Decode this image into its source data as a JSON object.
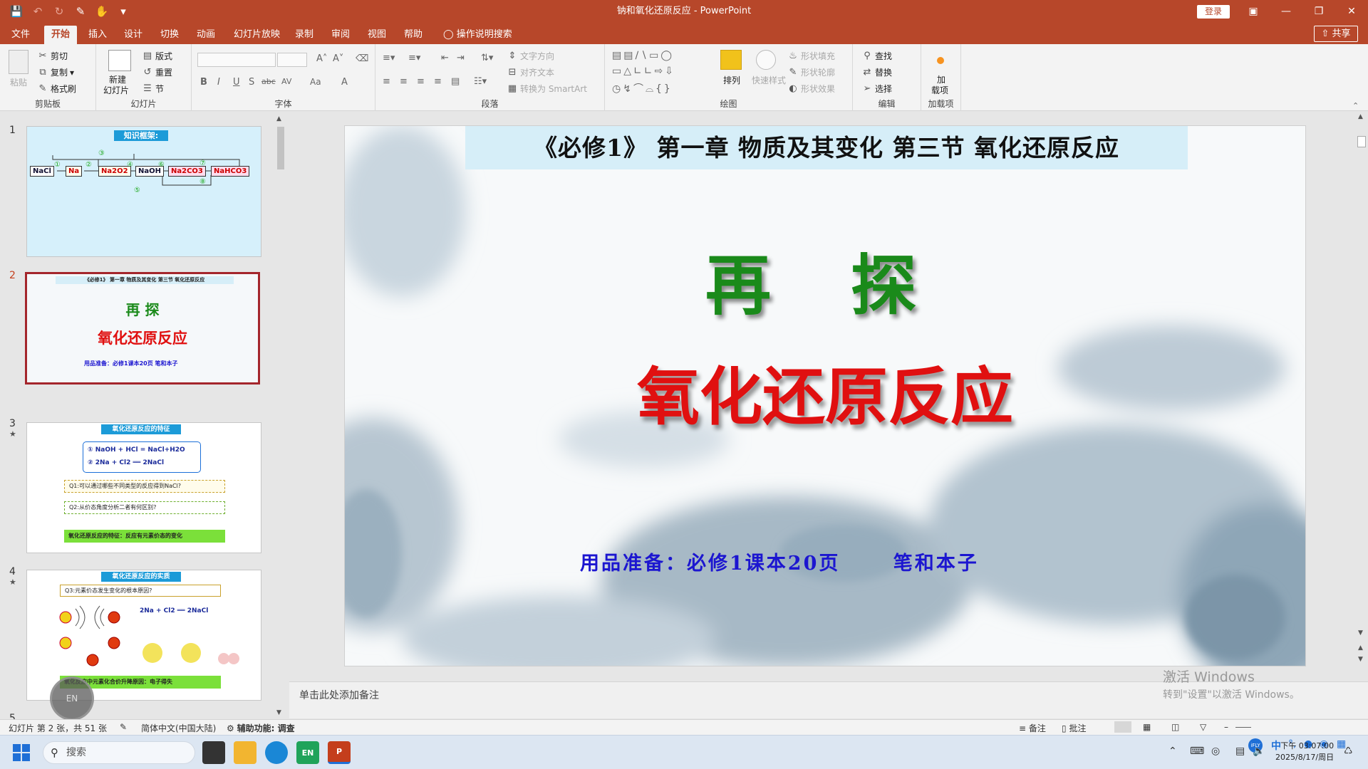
{
  "titlebar": {
    "doc_title": "钠和氧化还原反应  -  PowerPoint",
    "login_label": "登录",
    "bg_color": "#b7472a",
    "qat_icons": [
      "save-icon",
      "undo-icon",
      "redo-icon",
      "format-painter-icon",
      "touch-mode-icon",
      "customize-icon"
    ]
  },
  "menu": {
    "tabs": [
      "文件",
      "开始",
      "插入",
      "设计",
      "切换",
      "动画",
      "幻灯片放映",
      "录制",
      "审阅",
      "视图",
      "帮助"
    ],
    "active_tab": "开始",
    "search_label": "操作说明搜索",
    "share_label": "共享"
  },
  "ribbon": {
    "clipboard": {
      "label": "剪贴板",
      "paste": "粘贴",
      "cut": "剪切",
      "copy": "复制",
      "format_painter": "格式刷"
    },
    "slides": {
      "label": "幻灯片",
      "new_slide_line1": "新建",
      "new_slide_line2": "幻灯片",
      "layout": "版式",
      "reset": "重置",
      "section": "节"
    },
    "font": {
      "label": "字体",
      "buttons": [
        "B",
        "I",
        "U",
        "S",
        "abc",
        "AV",
        "Aa",
        "A"
      ]
    },
    "paragraph": {
      "label": "段落",
      "text_direction": "文字方向",
      "align_text": "对齐文本",
      "smartart": "转换为 SmartArt"
    },
    "drawing": {
      "label": "绘图",
      "arrange": "排列",
      "quick_styles": "快速样式",
      "shape_fill": "形状填充",
      "shape_outline": "形状轮廓",
      "shape_effects": "形状效果"
    },
    "editing": {
      "label": "编辑",
      "find": "查找",
      "replace": "替换",
      "select": "选择"
    },
    "addins": {
      "label": "加载项",
      "button_line1": "加",
      "button_line2": "载项"
    }
  },
  "thumbnails": [
    {
      "num": "1",
      "star": "",
      "title": "知识框架:",
      "nodes": [
        "NaCl",
        "Na",
        "Na2O2",
        "NaOH",
        "Na2CO3",
        "NaHCO3"
      ],
      "marks": [
        "①",
        "②",
        "③",
        "④",
        "⑤",
        "⑥",
        "⑦",
        "⑧"
      ]
    },
    {
      "num": "2",
      "star": "",
      "header": "《必修1》  第一章   物质及其变化     第三节  氧化还原反应",
      "t1": "再 探",
      "t2": "氧化还原反应",
      "note": "用品准备：必修1课本20页     笔和本子"
    },
    {
      "num": "3",
      "star": "★",
      "title": "氧化还原反应的特征",
      "eq1": "①   NaOH + HCl = NaCl+H2O",
      "eq2": "②   2Na + Cl2 ══ 2NaCl",
      "q1": "Q1:可以通过哪些不同类型的反应得到NaCl?",
      "q2": "Q2:从价态角度分析二者有何区别?",
      "concl": "氧化还原反应的特征：反应有元素价态的变化"
    },
    {
      "num": "4",
      "star": "★",
      "title": "氧化还原反应的实质",
      "q3": "Q3:元素价态发生变化的根本原因?",
      "eq": "2Na + Cl2 ══ 2NaCl",
      "concl": "氧化反应中元素化合价升降原因：电子得失"
    },
    {
      "num": "5",
      "star": "",
      "title": ""
    }
  ],
  "slide": {
    "header": "《必修1》  第一章    物质及其变化      第三节  氧化还原反应",
    "title1": "再 探",
    "title2": "氧化还原反应",
    "note": "用品准备：必修1课本20页      笔和本子",
    "title1_color": "#1a8a1a",
    "title2_color": "#e01010",
    "note_color": "#1c16d0",
    "header_bg": "#d6eef8"
  },
  "notes_placeholder": "单击此处添加备注",
  "watermark": {
    "line1": "激活 Windows",
    "line2": "转到\"设置\"以激活 Windows。"
  },
  "statusbar": {
    "slide_info": "幻灯片 第 2 张，共 51 张",
    "language": "简体中文(中国大陆)",
    "accessibility": "辅助功能: 调查",
    "notes": "备注",
    "comments": "批注"
  },
  "taskbar": {
    "search_placeholder": "搜索",
    "time": "下午 03:07:00",
    "date": "2025/8/17/周日",
    "ime": "中",
    "en_badge": "EN"
  }
}
